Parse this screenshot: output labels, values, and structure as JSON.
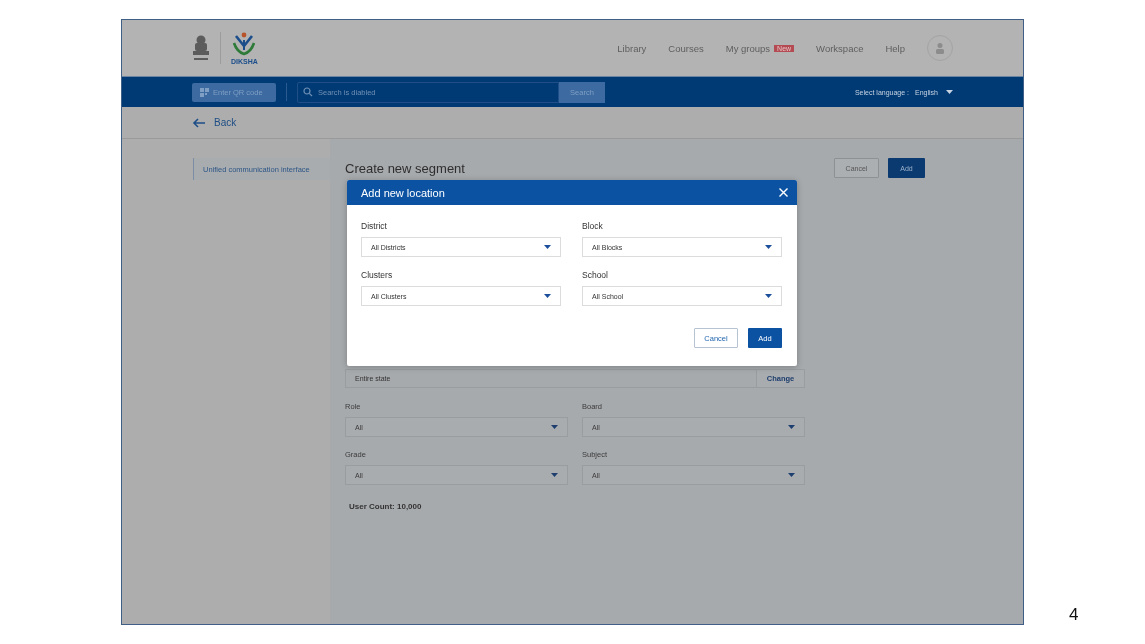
{
  "header": {
    "logo_text": "DIKSHA",
    "nav": [
      {
        "label": "Library"
      },
      {
        "label": "Courses"
      },
      {
        "label": "My groups",
        "badge": "New"
      },
      {
        "label": "Workspace"
      },
      {
        "label": "Help"
      }
    ]
  },
  "toolbar": {
    "qr_button": "Enter QR code",
    "search": {
      "placeholder": "Search is diabled"
    },
    "search_button": "Search",
    "language_label": "Select language :",
    "language": "English"
  },
  "back": "Back",
  "sidebar": {
    "items": [
      {
        "label": "Unified communication interface",
        "selected": true
      }
    ]
  },
  "page": {
    "title": "Create new segment",
    "buttons": [
      "Cancel",
      "Add"
    ],
    "location": {
      "value": "Entire state",
      "button": "Change"
    },
    "filters": [
      {
        "label": "Role",
        "value": "All"
      },
      {
        "label": "Board",
        "value": "All"
      },
      {
        "label": "Grade",
        "value": "All"
      },
      {
        "label": "Subject",
        "value": "All"
      }
    ],
    "user_count": "User Count: 10,000"
  },
  "dialog": {
    "title": "Add new location",
    "fields": [
      {
        "label": "District",
        "value": "All Districts"
      },
      {
        "label": "Block",
        "value": "All Blocks"
      },
      {
        "label": "Clusters",
        "value": "All Clusters"
      },
      {
        "label": "School",
        "value": "All School"
      }
    ],
    "buttons": [
      "Cancel",
      "Add"
    ]
  },
  "slide_number": "4"
}
